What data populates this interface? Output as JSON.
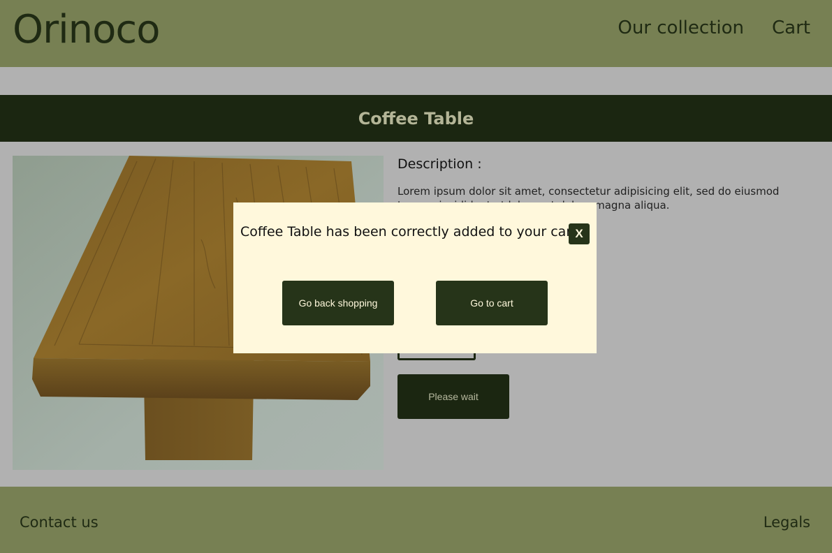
{
  "header": {
    "logo": "Orinoco",
    "nav": [
      "Our collection",
      "Cart"
    ]
  },
  "product": {
    "name": "Coffee Table",
    "description_title": "Description :",
    "description": "Lorem ipsum dolor sit amet, consectetur adipisicing elit, sed do eiusmod tempor incididunt ut labore et dolore magna aliqua.",
    "wait_button": "Please wait"
  },
  "modal": {
    "message": "Coffee Table has been correctly added to your cart",
    "close_label": "X",
    "back_button": "Go back shopping",
    "cart_button": "Go to cart"
  },
  "footer": {
    "contact": "Contact us",
    "legals": "Legals"
  },
  "colors": {
    "header_bg": "#778053",
    "title_bar_bg": "#1b2611",
    "modal_bg": "#fff8dc",
    "button_bg": "#263419",
    "overlay_page_bg": "#b1b1b1"
  }
}
